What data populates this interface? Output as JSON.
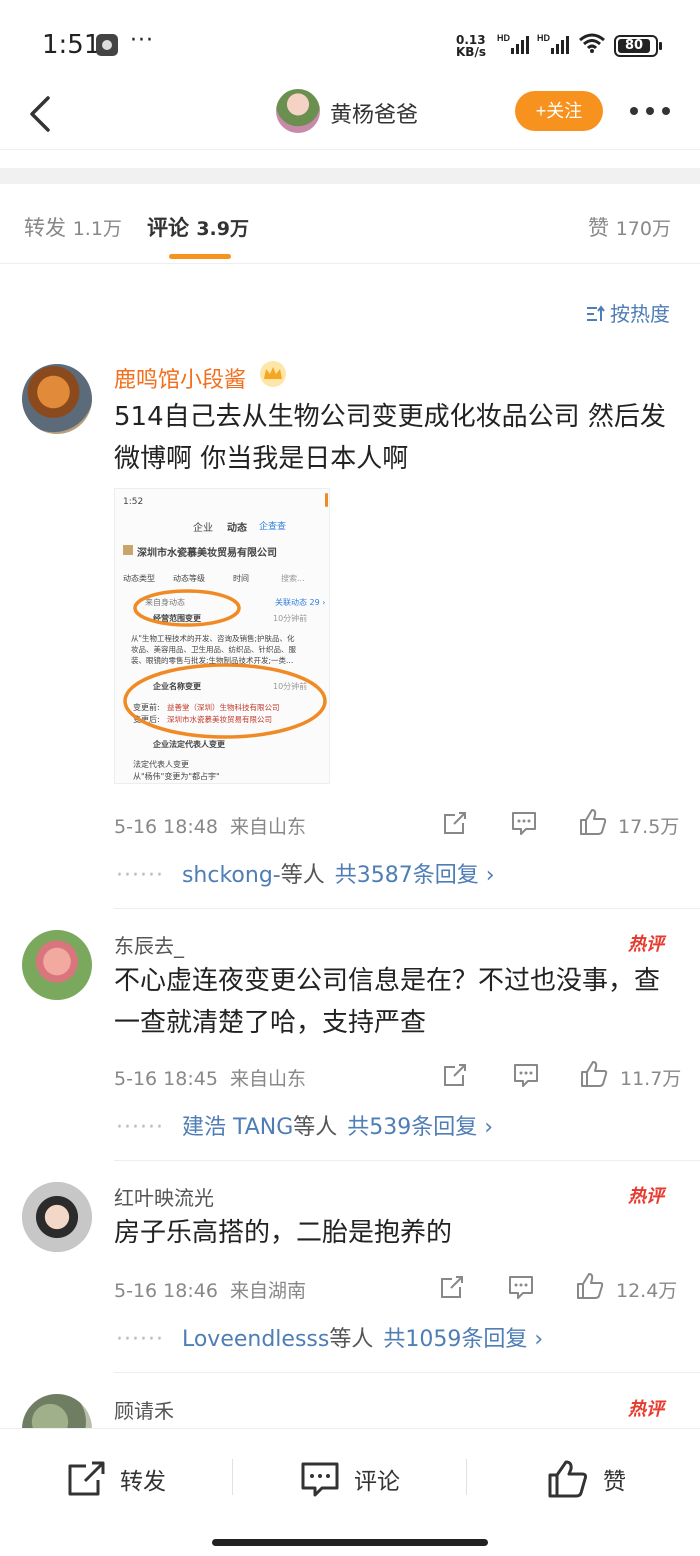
{
  "status_bar": {
    "time": "1:51",
    "dots": "···",
    "net_speed": "0.13 KB/s",
    "signal_1": "HD",
    "signal_2": "HD",
    "battery": "80"
  },
  "header": {
    "title": "黄杨爸爸",
    "follow_label": "+关注"
  },
  "tabs": [
    {
      "label": "转发",
      "count": "1.1万"
    },
    {
      "label": "评论",
      "count": "3.9万",
      "active": true
    },
    {
      "label": "赞",
      "count": "170万"
    }
  ],
  "sort_label": "按热度",
  "comments": [
    {
      "name": "鹿鸣馆小段酱",
      "badge": "crown-icon",
      "text": "514自己去从生物公司变更成化妆品公司 然后发微博啊 你当我是日本人啊",
      "time": "5-16 18:48",
      "location": "来自山东",
      "likes": "17.5万",
      "reply_user": "shckong-",
      "reply_suffix": "等人",
      "reply_count": "共3587条回复 ›"
    },
    {
      "name": "东辰去_",
      "tag": "热评",
      "text": "不心虚连夜变更公司信息是在？不过也没事，查一查就清楚了哈，支持严查",
      "time": "5-16 18:45",
      "location": "来自山东",
      "likes": "11.7万",
      "reply_user": "建浩 TANG",
      "reply_suffix": "等人",
      "reply_count": "共539条回复 ›"
    },
    {
      "name": "红叶映流光",
      "tag": "热评",
      "text": "房子乐高搭的，二胎是抱养的",
      "time": "5-16 18:46",
      "location": "来自湖南",
      "likes": "12.4万",
      "reply_user": "Loveendlesss",
      "reply_suffix": "等人",
      "reply_count": "共1059条回复 ›"
    },
    {
      "name": "顾请禾",
      "tag": "热评"
    }
  ],
  "embedded_screenshot": {
    "time": "1:52",
    "tabs": [
      "企业",
      "动态",
      "企查查"
    ],
    "company": "深圳市水瓷慕美妆贸易有限公司",
    "filters": [
      "动态类型",
      "动态等级",
      "时间",
      "搜索..."
    ],
    "self_events": "来自身动态",
    "related": "关联动态 29 ›",
    "event1_title": "经营范围变更",
    "event1_time": "10分钟前",
    "event1_body_1": "从\"生物工程技术的开发、咨询及销售;护肤品、化",
    "event1_body_2": "妆品、美容用品、卫生用品、纺织品、针织品、服",
    "event1_body_3": "装、眼镜的零售与批发;生物制品技术开发;一类...",
    "event2_title": "企业名称变更",
    "event2_time": "10分钟前",
    "before_label": "变更前:",
    "before_value": "益善堂（深圳）生物科技有限公司",
    "after_label": "变更后:",
    "after_value": "深圳市水瓷慕美妆贸易有限公司",
    "event3_title": "企业法定代表人变更",
    "event3_body_1": "法定代表人变更",
    "event3_body_2": "从\"杨伟\"变更为\"都占宇\""
  },
  "bottom_bar": {
    "repost": "转发",
    "comment": "评论",
    "like": "赞"
  },
  "colors": {
    "accent": "#f7921e",
    "link": "#4f7db5",
    "username": "#f36f1b",
    "hot": "#e83b2f"
  }
}
